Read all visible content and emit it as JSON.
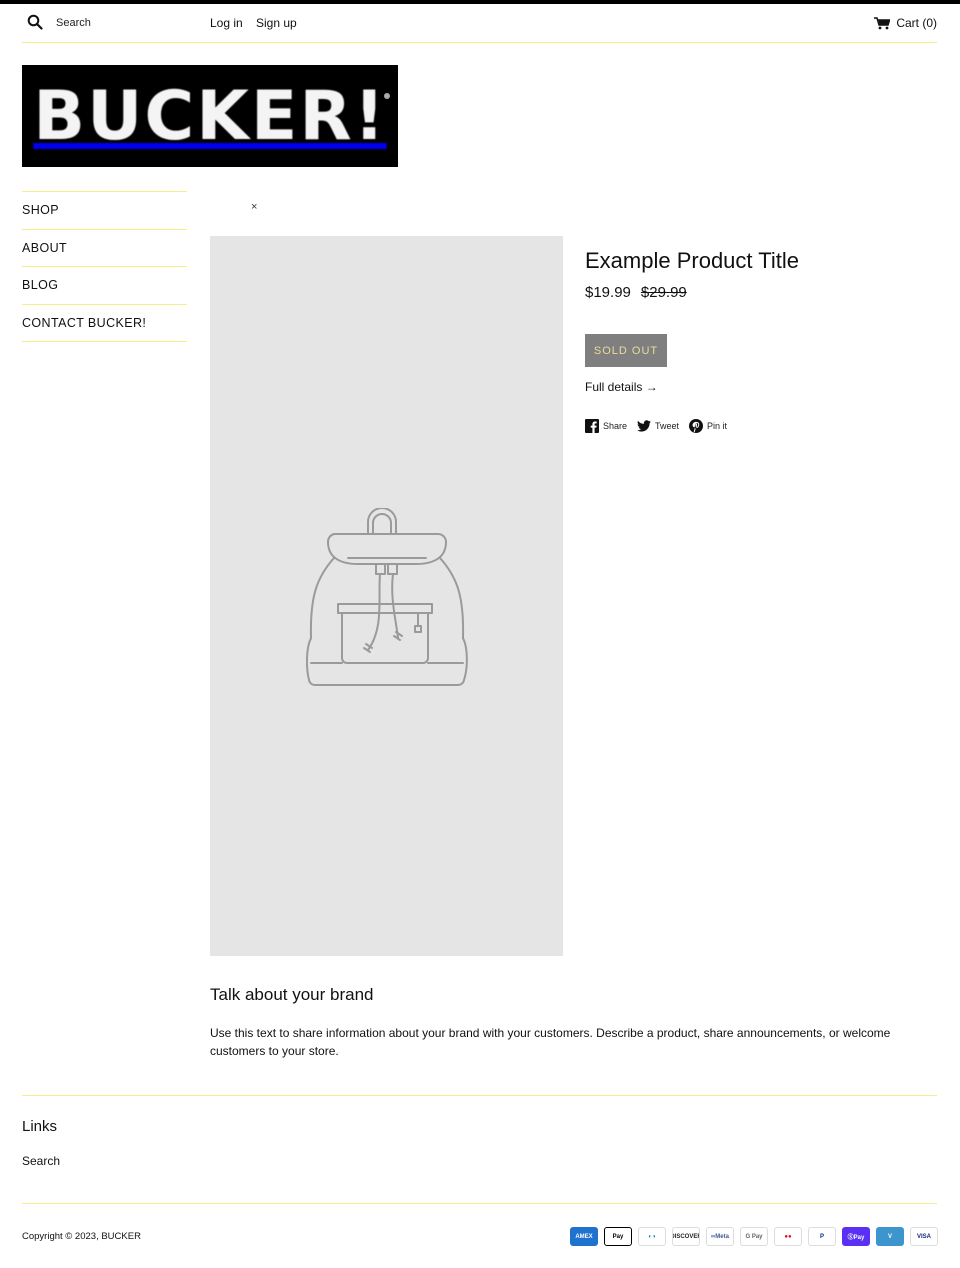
{
  "header": {
    "search_placeholder": "Search",
    "login_label": "Log in",
    "signup_label": "Sign up",
    "cart_label": "Cart (0)"
  },
  "logo": {
    "text": "BUCKER!"
  },
  "nav": {
    "items": [
      {
        "label": "SHOP"
      },
      {
        "label": "ABOUT"
      },
      {
        "label": "BLOG"
      },
      {
        "label": "CONTACT BUCKER!"
      }
    ]
  },
  "quickview": {
    "close_glyph": "×"
  },
  "product": {
    "title": "Example Product Title",
    "price": "$19.99",
    "compare_price": "$29.99",
    "sold_out_label": "SOLD OUT",
    "full_details_label": "Full details →",
    "share": {
      "facebook_label": "Share",
      "twitter_label": "Tweet",
      "pinterest_label": "Pin it"
    }
  },
  "brand": {
    "title": "Talk about your brand",
    "text": "Use this text to share information about your brand with your customers. Describe a product, share announcements, or welcome customers to your store."
  },
  "footer": {
    "links_title": "Links",
    "links": [
      {
        "label": "Search"
      }
    ],
    "copyright": "Copyright © 2023, BUCKER",
    "payments": [
      {
        "name": "amex",
        "label": "AMEX",
        "bg": "#1f72cd",
        "fg": "#ffffff"
      },
      {
        "name": "apple-pay",
        "label": "Pay",
        "bg": "#ffffff",
        "fg": "#000000"
      },
      {
        "name": "diners-club",
        "label": "◐◑",
        "bg": "#ffffff",
        "fg": "#0079be"
      },
      {
        "name": "discover",
        "label": "DISCOVER",
        "bg": "#ffffff",
        "fg": "#231f20"
      },
      {
        "name": "meta-pay",
        "label": "∞Meta",
        "bg": "#ffffff",
        "fg": "#3d5a98"
      },
      {
        "name": "google-pay",
        "label": "G Pay",
        "bg": "#ffffff",
        "fg": "#5f6368"
      },
      {
        "name": "mastercard",
        "label": "●●",
        "bg": "#ffffff",
        "fg": "#eb001b"
      },
      {
        "name": "paypal",
        "label": "P",
        "bg": "#ffffff",
        "fg": "#003087"
      },
      {
        "name": "shop-pay",
        "label": "ⓈPay",
        "bg": "#5a31f4",
        "fg": "#ffffff"
      },
      {
        "name": "venmo",
        "label": "V",
        "bg": "#3d95ce",
        "fg": "#ffffff"
      },
      {
        "name": "visa",
        "label": "VISA",
        "bg": "#ffffff",
        "fg": "#142688"
      }
    ]
  }
}
